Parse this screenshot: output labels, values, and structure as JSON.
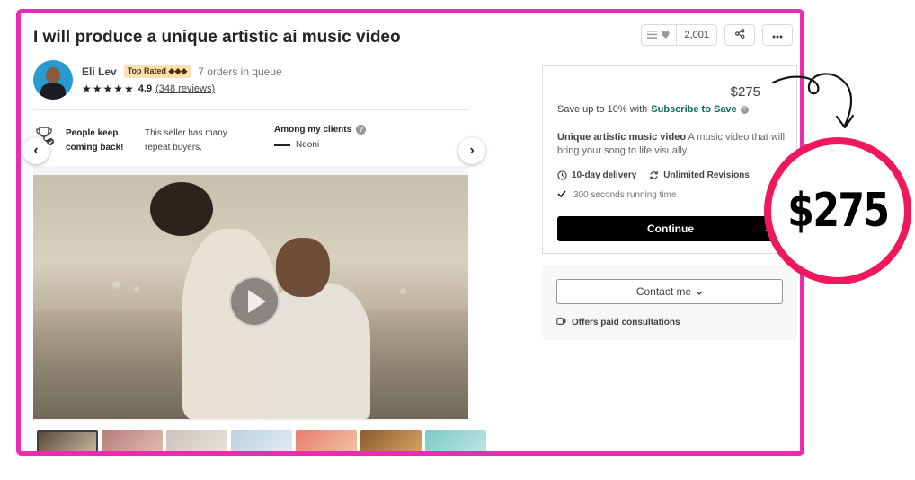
{
  "gig": {
    "title": "I will produce a unique artistic ai music video",
    "collections_count": "2,001"
  },
  "seller": {
    "name": "Eli Lev",
    "badge": "Top Rated ◆◆◆",
    "queue": "7 orders in queue",
    "stars": "★★★★★",
    "rating": "4.9",
    "reviews": "(348 reviews)"
  },
  "stats": {
    "title": "People keep coming back!",
    "desc": "This seller has many repeat buyers.",
    "clients_title": "Among my clients",
    "client_name": "Neoni"
  },
  "package": {
    "price": "$275",
    "save_prefix": "Save up to 10% with",
    "save_link": "Subscribe to Save",
    "desc_title": "Unique artistic music video",
    "desc_text": " A music video that will bring your song to life visually.",
    "delivery": "10-day delivery",
    "revisions": "Unlimited Revisions",
    "running_time": "300 seconds running time",
    "continue_label": "Continue"
  },
  "contact": {
    "button_label": "Contact me",
    "consult": "Offers paid consultations"
  },
  "annotation": {
    "price_highlight": "$275",
    "circle_color": "#f0185d",
    "frame_color": "#ee2ab3"
  },
  "icons": {
    "menu": "list-icon",
    "heart": "heart-icon",
    "share": "share-icon",
    "more": "more-icon",
    "clock": "clock-icon",
    "revisions": "refresh-icon",
    "check": "check-icon",
    "video": "video-icon"
  }
}
